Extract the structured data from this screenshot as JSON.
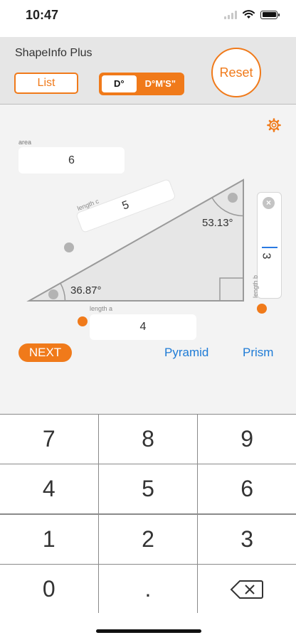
{
  "status_bar": {
    "time": "10:47"
  },
  "header": {
    "app_title": "ShapeInfo Plus",
    "list_button": "List",
    "angle_mode_options": [
      "D°",
      "D°M'S\""
    ],
    "reset_button": "Reset"
  },
  "triangle": {
    "area_label": "area",
    "area_value": "6",
    "length_a_label": "length a",
    "length_a_value": "4",
    "length_b_label": "length b",
    "length_b_value": "3",
    "length_c_label": "length c",
    "length_c_value": "5",
    "angle_bottom_left": "36.87°",
    "angle_top_right": "53.13°"
  },
  "actions": {
    "next_button": "NEXT",
    "pyramid_link": "Pyramid",
    "prism_link": "Prism"
  },
  "keypad": {
    "keys": [
      "7",
      "8",
      "9",
      "4",
      "5",
      "6",
      "1",
      "2",
      "3",
      "0",
      "."
    ],
    "backspace_icon": "backspace-icon"
  },
  "colors": {
    "accent": "#f07a1a",
    "link": "#1e7bd6",
    "caret": "#2a7ae2"
  }
}
